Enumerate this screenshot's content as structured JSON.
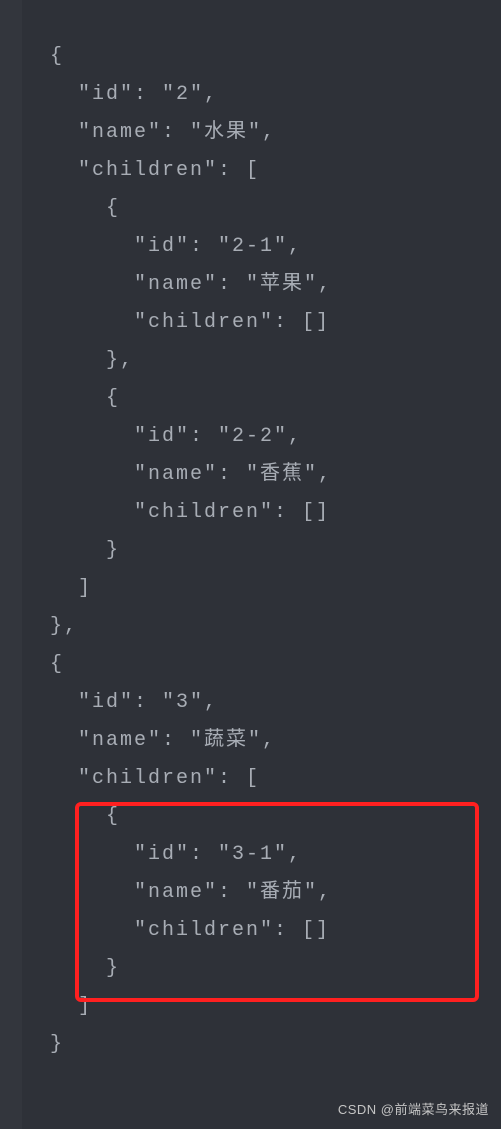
{
  "code": {
    "lines": [
      "  {",
      "    \"id\": \"2\",",
      "    \"name\": \"水果\",",
      "    \"children\": [",
      "      {",
      "        \"id\": \"2-1\",",
      "        \"name\": \"苹果\",",
      "        \"children\": []",
      "      },",
      "      {",
      "        \"id\": \"2-2\",",
      "        \"name\": \"香蕉\",",
      "        \"children\": []",
      "      }",
      "    ]",
      "  },",
      "  {",
      "    \"id\": \"3\",",
      "    \"name\": \"蔬菜\",",
      "    \"children\": [",
      "      {",
      "        \"id\": \"3-1\",",
      "        \"name\": \"番茄\",",
      "        \"children\": []",
      "      }",
      "    ]",
      "  }"
    ]
  },
  "watermark": "CSDN @前端菜鸟来报道",
  "highlighted_content": {
    "id": "3-1",
    "name": "番茄",
    "children": []
  },
  "colors": {
    "background": "#2e3138",
    "gutter": "#33363d",
    "text": "#a8adb5",
    "highlight_border": "#ff2020"
  }
}
